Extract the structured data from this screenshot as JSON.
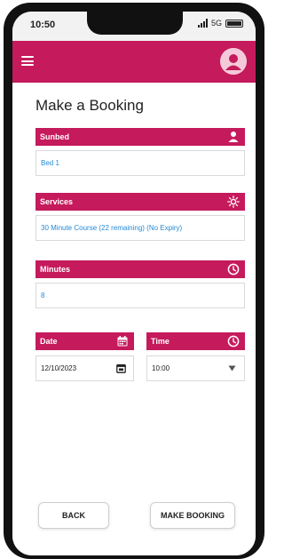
{
  "status_bar": {
    "time": "10:50",
    "network": "5G"
  },
  "app_bar": {
    "menu_icon": "hamburger-menu-icon",
    "avatar_icon": "user-avatar-icon"
  },
  "page": {
    "title": "Make a Booking"
  },
  "colors": {
    "brand": "#c51a5b",
    "link": "#2489d6"
  },
  "fields": {
    "sunbed": {
      "label": "Sunbed",
      "icon": "person-icon",
      "value": "Bed 1"
    },
    "services": {
      "label": "Services",
      "icon": "sun-icon",
      "value": "30 Minute Course (22 remaining) (No Expiry)"
    },
    "minutes": {
      "label": "Minutes",
      "icon": "clock-icon",
      "value": "8"
    },
    "date": {
      "label": "Date",
      "icon": "calendar-icon",
      "value": "12/10/2023",
      "picker_icon": "calendar-picker-icon"
    },
    "time": {
      "label": "Time",
      "icon": "clock-icon",
      "value": "10:00",
      "dropdown_icon": "dropdown-arrow-icon"
    }
  },
  "buttons": {
    "back": "BACK",
    "make_booking": "MAKE BOOKING"
  }
}
